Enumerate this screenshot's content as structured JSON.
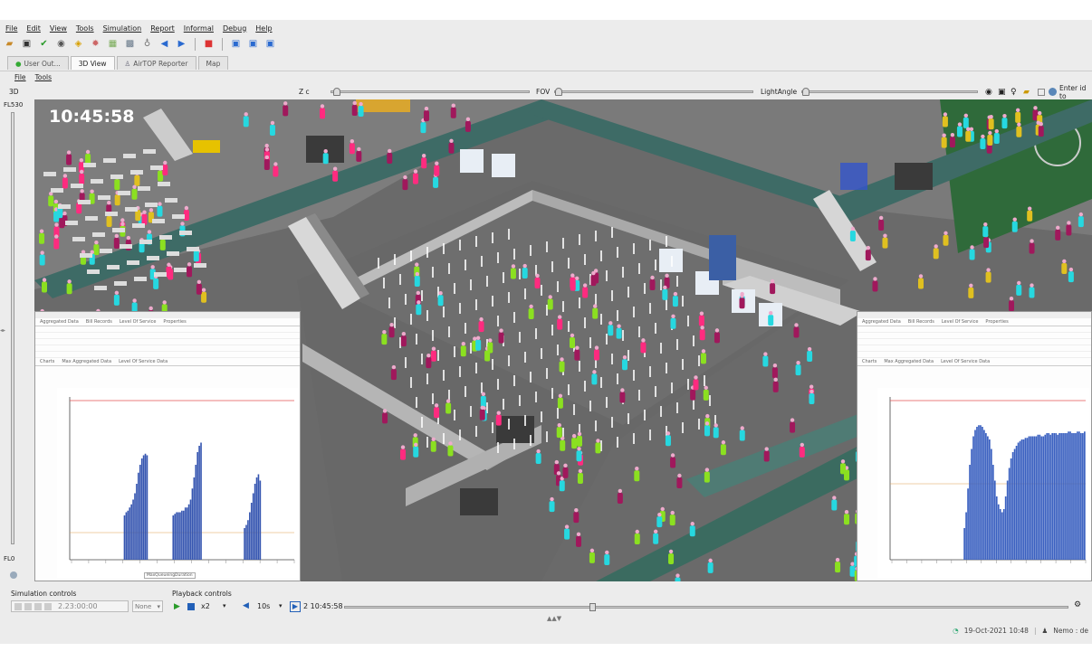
{
  "menu": [
    "File",
    "Edit",
    "View",
    "Tools",
    "Simulation",
    "Report",
    "Informal",
    "Debug",
    "Help"
  ],
  "toolbar_icons": [
    "open-folder-icon",
    "save-icon",
    "check-icon",
    "eye-icon",
    "warning-icon",
    "gear-icon",
    "grid-icon",
    "blocks-icon",
    "lightbulb-icon",
    "arrow-left-icon",
    "arrow-right-icon",
    "stop-icon",
    "window-icon",
    "window-icon",
    "window-icon"
  ],
  "tabs": [
    {
      "label": "User Out...",
      "active": false,
      "icon": "user-icon"
    },
    {
      "label": "3D View",
      "active": true
    },
    {
      "label": "AirTOP Reporter",
      "active": false,
      "icon": "reporter-icon"
    },
    {
      "label": "Map",
      "active": false
    }
  ],
  "subtabs": [
    "File",
    "Tools"
  ],
  "controls": {
    "mode": "3D",
    "z_label": "Z c",
    "fov_label": "FOV",
    "light_label": "LightAngle",
    "search_placeholder": "Enter id to"
  },
  "floors": {
    "top": "FL530",
    "bottom": "FL0"
  },
  "viewport": {
    "time": "10:45:58"
  },
  "sim": {
    "label": "Simulation controls",
    "time": "2.23:00:00",
    "dropdown": "None"
  },
  "playback": {
    "label": "Playback controls",
    "speed": "x2",
    "step": "10s",
    "time": "2 10:45:58"
  },
  "status": {
    "date": "19-Oct-2021 10:48",
    "user": "Nemo : de"
  },
  "left_panel": {
    "tabs": [
      "Aggregated Data",
      "Bill Records",
      "Level Of Service",
      "Properties"
    ],
    "subtabs": [
      "Charts",
      "Max Aggregated Data",
      "Level Of Service Data"
    ],
    "legend": "MaxQueueingDuration",
    "bars": [
      0,
      0,
      0,
      0,
      0,
      0,
      0,
      0,
      0,
      0,
      0,
      0,
      0,
      0,
      0,
      0,
      0,
      0,
      0,
      0,
      0,
      0,
      0,
      0,
      0,
      0,
      0,
      0,
      0,
      0,
      28,
      30,
      31,
      33,
      35,
      38,
      42,
      48,
      55,
      60,
      64,
      66,
      67,
      66,
      0,
      0,
      0,
      0,
      0,
      0,
      0,
      0,
      0,
      0,
      0,
      0,
      0,
      0,
      28,
      29,
      30,
      30,
      30,
      31,
      31,
      33,
      33,
      35,
      38,
      45,
      52,
      60,
      68,
      72,
      74,
      0,
      0,
      0,
      0,
      0,
      0,
      0,
      0,
      0,
      0,
      0,
      0,
      0,
      0,
      0,
      0,
      0,
      0,
      0,
      0,
      0,
      0,
      0,
      0,
      20,
      22,
      25,
      30,
      36,
      42,
      48,
      52,
      54,
      50,
      0,
      0,
      0,
      0,
      0,
      0,
      0,
      0,
      0,
      0,
      0,
      0,
      0,
      0,
      0,
      0,
      0,
      0,
      0
    ]
  },
  "right_panel": {
    "tabs": [
      "Aggregated Data",
      "Bill Records",
      "Level Of Service",
      "Properties"
    ],
    "subtabs": [
      "Charts",
      "Max Aggregated Data",
      "Level Of Service Data"
    ],
    "bars": [
      0,
      0,
      0,
      0,
      0,
      0,
      0,
      0,
      0,
      0,
      0,
      0,
      0,
      0,
      0,
      0,
      0,
      0,
      0,
      0,
      0,
      0,
      0,
      0,
      0,
      0,
      0,
      0,
      0,
      0,
      0,
      0,
      0,
      0,
      0,
      0,
      0,
      0,
      0,
      0,
      20,
      30,
      45,
      60,
      70,
      78,
      82,
      84,
      85,
      85,
      84,
      82,
      80,
      78,
      76,
      70,
      60,
      50,
      40,
      35,
      32,
      30,
      32,
      40,
      50,
      58,
      64,
      68,
      70,
      72,
      74,
      75,
      76,
      76,
      77,
      77,
      78,
      78,
      78,
      78,
      78,
      79,
      79,
      78,
      78,
      79,
      80,
      80,
      79,
      80,
      80,
      80,
      79,
      80,
      80,
      80,
      80,
      80,
      81,
      81,
      80,
      80,
      80,
      81,
      81,
      80,
      80,
      81
    ]
  }
}
